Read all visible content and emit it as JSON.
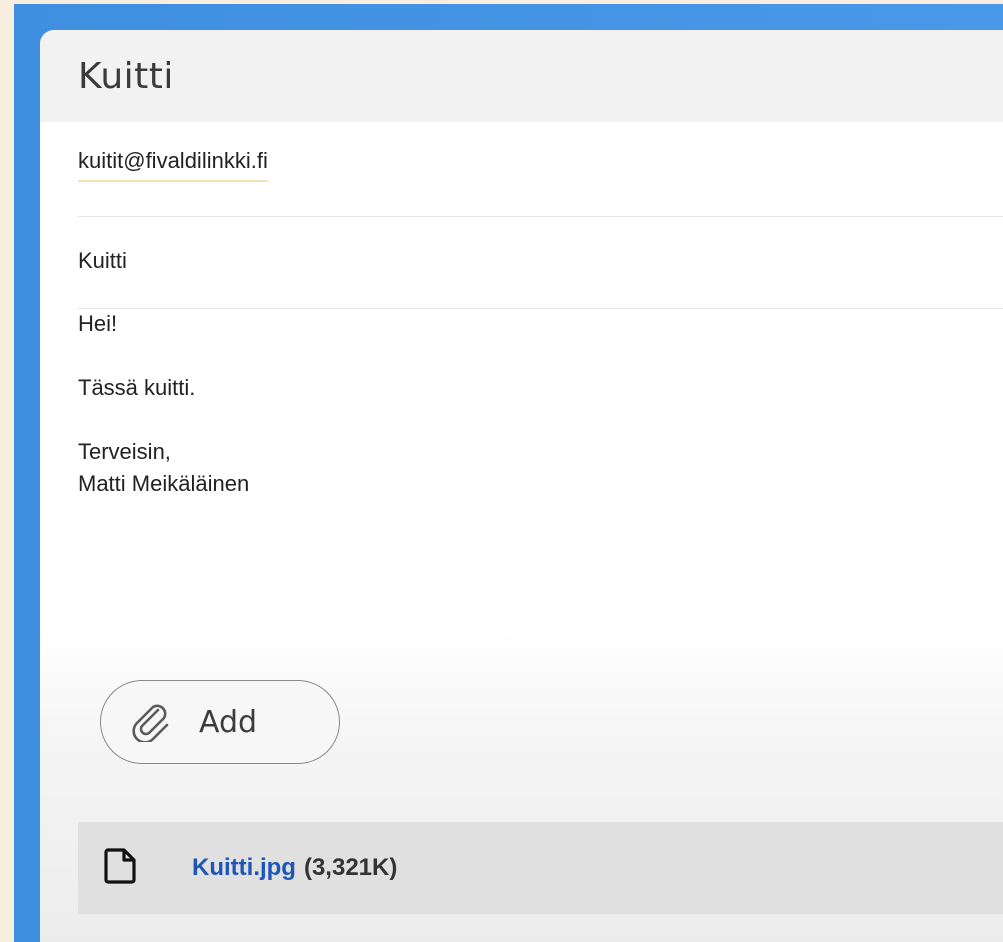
{
  "compose": {
    "title": "Kuitti",
    "to": "kuitit@fivaldilinkki.fi",
    "subject": "Kuitti",
    "body_lines": [
      "Hei!",
      "",
      "Tässä kuitti.",
      "",
      "Terveisin,",
      "Matti Meikäläinen"
    ]
  },
  "actions": {
    "add_label": "Add"
  },
  "attachment": {
    "name": "Kuitti.jpg",
    "size": "(3,321K)"
  },
  "icons": {
    "add": "paperclip-icon",
    "attachment": "file-icon"
  },
  "colors": {
    "frame": "#4a98e8",
    "link": "#1e56b8",
    "background": "#f8eee0"
  }
}
